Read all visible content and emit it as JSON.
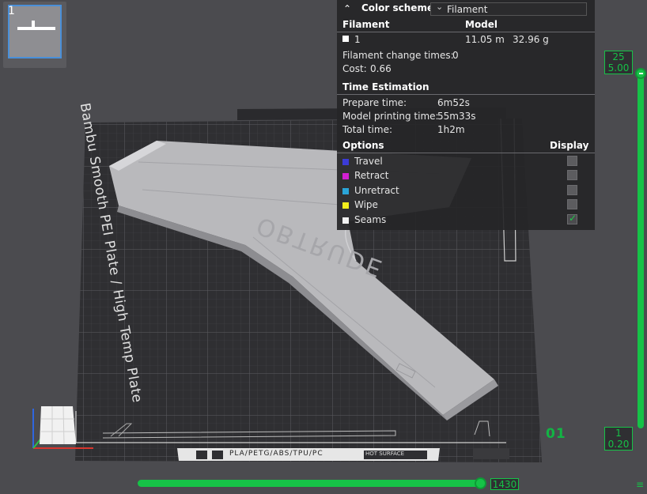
{
  "thumbnail": {
    "plate_number": "1"
  },
  "legend": {
    "collapse_icon": "double-chevron-up-icon",
    "title": "Color scheme",
    "scheme_value": "Filament",
    "headers": {
      "filament": "Filament",
      "model": "Model"
    },
    "filament_row": {
      "id": "1",
      "length": "11.05 m",
      "weight": "32.96 g",
      "color": "#ffffff"
    },
    "change_times_label": "Filament change times:",
    "change_times_value": "0",
    "cost_label": "Cost:",
    "cost_value": "0.66",
    "time_section": "Time Estimation",
    "prepare_label": "Prepare time:",
    "prepare_value": "6m52s",
    "model_time_label": "Model printing time:",
    "model_time_value": "55m33s",
    "total_label": "Total time:",
    "total_value": "1h2m",
    "options_header": "Options",
    "display_header": "Display",
    "options": [
      {
        "label": "Travel",
        "color": "#3b3bd6",
        "checked": false
      },
      {
        "label": "Retract",
        "color": "#d21fd2",
        "checked": false
      },
      {
        "label": "Unretract",
        "color": "#2aa5d8",
        "checked": false
      },
      {
        "label": "Wipe",
        "color": "#f2ee1c",
        "checked": false
      },
      {
        "label": "Seams",
        "color": "#f2f2f2",
        "checked": true
      }
    ]
  },
  "bed": {
    "plate_label": "Bambu Smooth PEI Plate / High Temp Plate",
    "materials": "PLA/PETG/ABS/TPU/PC",
    "surface_label": "HOT SURFACE"
  },
  "model": {
    "embossed_text": "OBTRUDE"
  },
  "layer_slider": {
    "top_layer": "25",
    "top_height": "5.00",
    "bottom_layer": "1",
    "bottom_height": "0.20"
  },
  "move_slider": {
    "value": "1430"
  },
  "plate_index": "01",
  "colors": {
    "accent": "#16c247",
    "panel": "#262628",
    "bed": "#2f2f32"
  }
}
